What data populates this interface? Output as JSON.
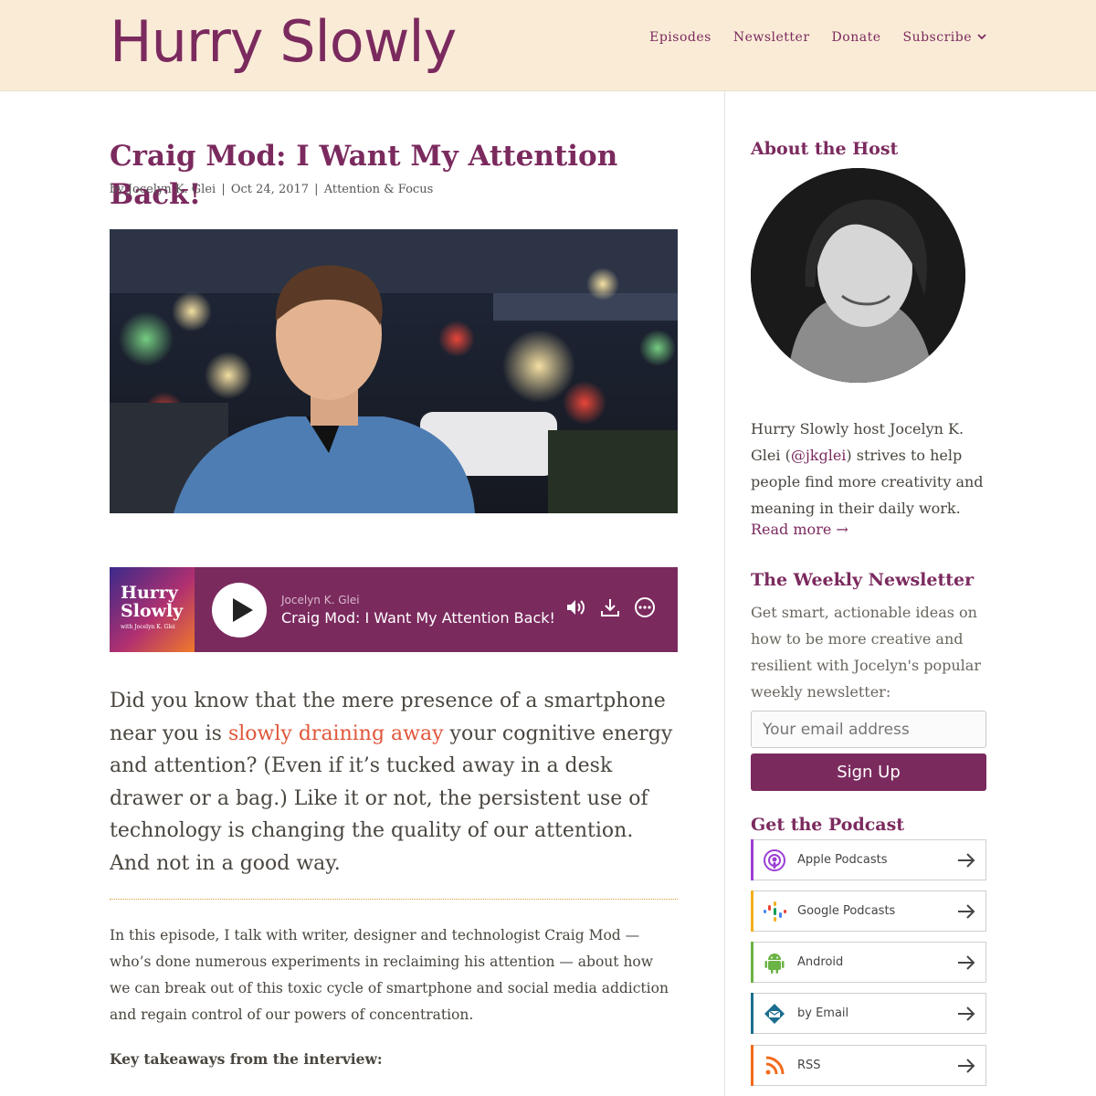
{
  "header": {
    "logo": "Hurry Slowly",
    "nav": [
      {
        "label": "Episodes"
      },
      {
        "label": "Newsletter"
      },
      {
        "label": "Donate"
      },
      {
        "label": "Subscribe",
        "has_dropdown": true
      }
    ]
  },
  "post": {
    "title": "Craig Mod: I Want My Attention Back!",
    "meta": {
      "by": "by Jocelyn K. Glei",
      "sep1": " | ",
      "date": "Oct 24, 2017",
      "sep2": " | ",
      "category": "Attention & Focus"
    },
    "player": {
      "art_title": "Hurry Slowly",
      "art_subtitle": "with Jocelyn K. Glei",
      "author": "Jocelyn K. Glei",
      "episode": "Craig Mod: I Want My Attention Back!"
    },
    "lead": {
      "part1": "Did you know that the mere presence of a smartphone near you is ",
      "highlight": "slowly draining away",
      "part2": " your cognitive energy and attention? (Even if it’s tucked away in a desk drawer or a bag.) Like it or not, the persistent use of technology is changing the quality of our attention. And not in a good way."
    },
    "body": "In this episode, I talk with writer, designer and technologist Craig Mod — who’s done numerous experiments in reclaiming his attention — about how we can break out of this toxic cycle of smartphone and social media addiction and regain control of our powers of concentration.",
    "takeaways_heading": "Key takeaways from the interview:"
  },
  "sidebar": {
    "about": {
      "heading": "About the Host",
      "text1": "Hurry Slowly host Jocelyn K. Glei (",
      "handle": "@jkglei",
      "text2": ") strives to help people find more creativity and meaning in their daily work.",
      "read_more": "Read more →"
    },
    "newsletter": {
      "heading": "The Weekly Newsletter",
      "text": "Get smart, actionable ideas on how to be more creative and resilient with Jocelyn's popular weekly newsletter:",
      "email_placeholder": "Your email address",
      "signup": "Sign Up"
    },
    "podcast": {
      "heading": "Get the Podcast",
      "items": [
        {
          "label": "Apple Podcasts",
          "icon": "apple-podcasts-icon",
          "color": "#9b3fd4"
        },
        {
          "label": "Google Podcasts",
          "icon": "google-podcasts-icon",
          "color": "#f2b01e"
        },
        {
          "label": "Android",
          "icon": "android-icon",
          "color": "#6ab344"
        },
        {
          "label": "by Email",
          "icon": "email-icon",
          "color": "#1b6e8f"
        },
        {
          "label": "RSS",
          "icon": "rss-icon",
          "color": "#f26b1d"
        }
      ]
    }
  },
  "colors": {
    "brand": "#7b2a5e",
    "header_bg": "#faebd7",
    "highlight": "#e0563a"
  }
}
